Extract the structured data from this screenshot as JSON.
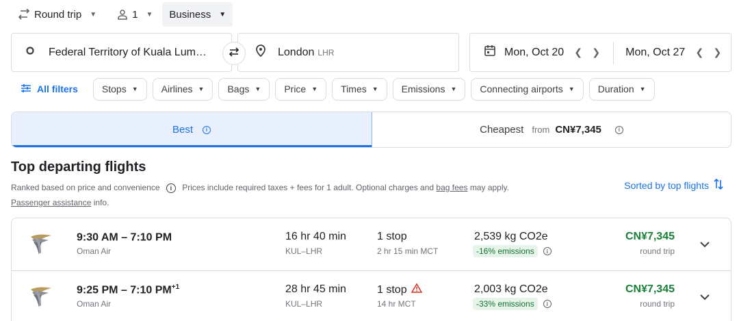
{
  "search": {
    "trip_type": "Round trip",
    "passengers": "1",
    "cabin_class": "Business",
    "origin": "Federal Territory of Kuala Lum…",
    "destination": "London",
    "destination_code": "LHR",
    "depart_date": "Mon, Oct 20",
    "return_date": "Mon, Oct 27"
  },
  "filters": {
    "all_filters": "All filters",
    "chips": [
      "Stops",
      "Airlines",
      "Bags",
      "Price",
      "Times",
      "Emissions",
      "Connecting airports",
      "Duration"
    ]
  },
  "tabs": {
    "best": "Best",
    "cheapest": "Cheapest",
    "from_label": "from",
    "cheapest_price": "CN¥7,345"
  },
  "results_header": {
    "title": "Top departing flights",
    "ranked_text": "Ranked based on price and convenience",
    "prices_text": "Prices include required taxes + fees for 1 adult. Optional charges and",
    "bag_fees_link": "bag fees",
    "may_apply": "may apply.",
    "assistance_link": "Passenger assistance",
    "info_suffix": "info.",
    "sort_label": "Sorted by top flights"
  },
  "flights": [
    {
      "times": "9:30 AM – 7:10 PM",
      "day_offset": "",
      "airline": "Oman Air",
      "duration": "16 hr 40 min",
      "route": "KUL–LHR",
      "stops": "1 stop",
      "stop_warning": false,
      "stop_detail": "2 hr 15 min MCT",
      "co2": "2,539 kg CO2e",
      "emissions": "-16% emissions",
      "price": "CN¥7,345",
      "price_type": "round trip"
    },
    {
      "times": "9:25 PM – 7:10 PM",
      "day_offset": "+1",
      "airline": "Oman Air",
      "duration": "28 hr 45 min",
      "route": "KUL–LHR",
      "stops": "1 stop",
      "stop_warning": true,
      "stop_detail": "14 hr MCT",
      "co2": "2,003 kg CO2e",
      "emissions": "-33% emissions",
      "price": "CN¥7,345",
      "price_type": "round trip"
    }
  ],
  "colors": {
    "accent": "#1a73e8",
    "price_green": "#188038",
    "emissions_bg": "#e6f4ea",
    "warning_red": "#d93025"
  },
  "icons": [
    "swap-arrows-icon",
    "person-icon",
    "circle-icon",
    "location-pin-icon",
    "swap-icon",
    "calendar-icon",
    "filter-sliders-icon",
    "sort-arrows-icon",
    "warning-icon",
    "chevron-down-icon"
  ]
}
